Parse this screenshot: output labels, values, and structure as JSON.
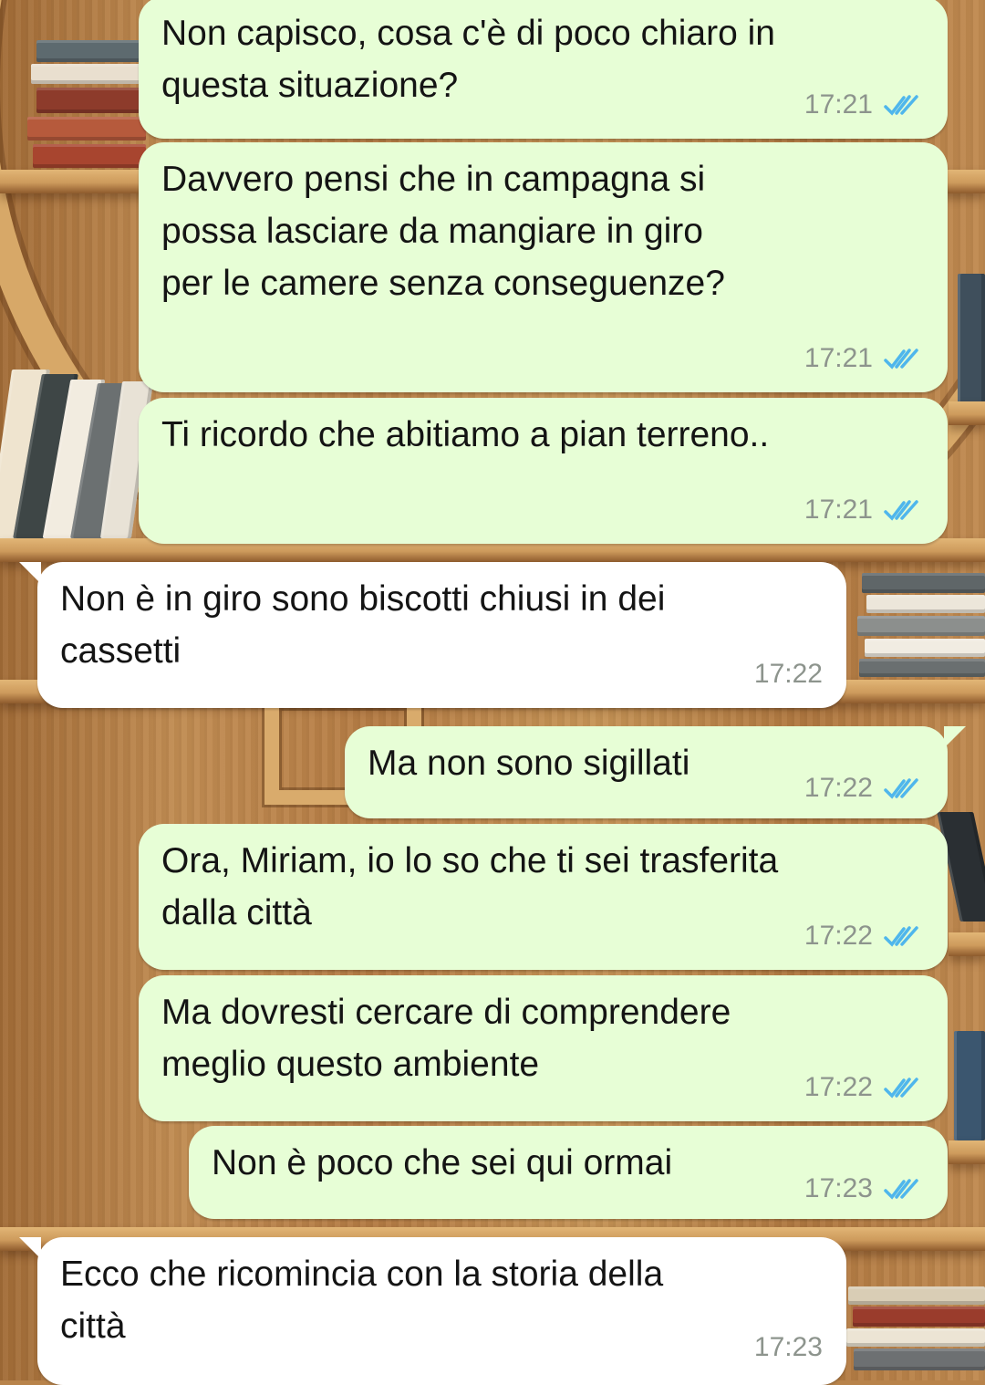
{
  "chat": {
    "messages": [
      {
        "direction": "out",
        "text": "Non capisco, cosa c'è di poco chiaro in\nquesta situazione?",
        "time": "17:21",
        "status": "read-ticks-icon"
      },
      {
        "direction": "out",
        "text": "Davvero pensi che in campagna si\npossa lasciare da mangiare in giro\nper le camere senza conseguenze?",
        "time": "17:21",
        "status": "read-ticks-icon"
      },
      {
        "direction": "out",
        "text": "Ti ricordo che abitiamo a pian terreno..",
        "time": "17:21",
        "status": "read-ticks-icon"
      },
      {
        "direction": "in",
        "text": "Non è in giro sono biscotti chiusi in dei\ncassetti",
        "time": "17:22"
      },
      {
        "direction": "out",
        "text": "Ma non sono sigillati",
        "time": "17:22",
        "status": "read-ticks-icon"
      },
      {
        "direction": "out",
        "text": "Ora, Miriam, io lo so che ti sei trasferita\ndalla città",
        "time": "17:22",
        "status": "read-ticks-icon"
      },
      {
        "direction": "out",
        "text": "Ma dovresti cercare di comprendere\nmeglio questo ambiente",
        "time": "17:22",
        "status": "read-ticks-icon"
      },
      {
        "direction": "out",
        "text": "Non è poco che sei qui ormai",
        "time": "17:23",
        "status": "read-ticks-icon"
      },
      {
        "direction": "in",
        "text": "Ecco che ricomincia con la storia della\ncittà",
        "time": "17:23"
      }
    ]
  },
  "colors": {
    "outgoing_bubble": "#e7fed6",
    "incoming_bubble": "#ffffff",
    "read_ticks": "#4fb6ec",
    "timestamp": "#8d948d"
  },
  "background": "wooden-bookshelf-wallpaper"
}
